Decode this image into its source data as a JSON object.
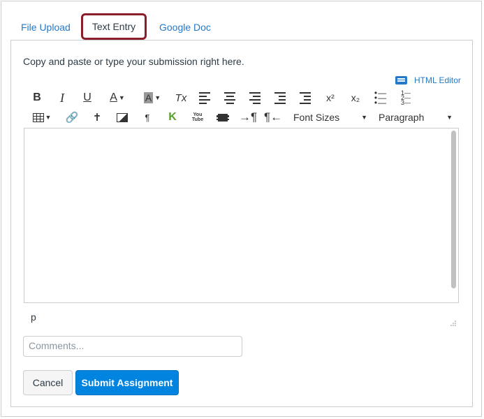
{
  "tabs": {
    "file_upload": "File Upload",
    "text_entry": "Text Entry",
    "google_doc": "Google Doc"
  },
  "instructions": "Copy and paste or type your submission right here.",
  "html_editor_label": "HTML Editor",
  "toolbar": {
    "bold": "B",
    "italic": "I",
    "underline": "U",
    "text_color": "A",
    "background_color": "A",
    "clear_formatting": "Tx",
    "superscript": "x²",
    "subscript": "x₂",
    "paragraph_mark": "¶",
    "youtube": "You Tube",
    "font_sizes": "Font Sizes",
    "paragraph_format": "Paragraph"
  },
  "status_path": "p",
  "comments": {
    "placeholder": "Comments...",
    "value": ""
  },
  "buttons": {
    "cancel": "Cancel",
    "submit": "Submit Assignment"
  },
  "colors": {
    "link_blue": "#2479c8",
    "active_tab_border": "#8a1f2b",
    "submit_blue": "#0084e0",
    "text": "#2d3b45"
  }
}
